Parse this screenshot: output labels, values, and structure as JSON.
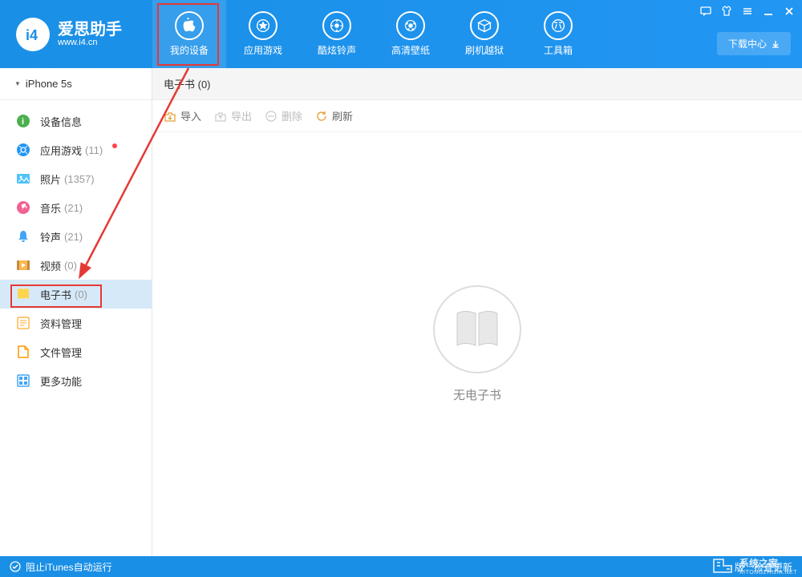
{
  "logo": {
    "title": "爱思助手",
    "url": "www.i4.cn"
  },
  "nav": [
    {
      "label": "我的设备",
      "active": true
    },
    {
      "label": "应用游戏",
      "active": false
    },
    {
      "label": "酷炫铃声",
      "active": false
    },
    {
      "label": "高清壁纸",
      "active": false
    },
    {
      "label": "刷机越狱",
      "active": false
    },
    {
      "label": "工具箱",
      "active": false
    }
  ],
  "download_center": "下载中心",
  "device_name": "iPhone 5s",
  "sidebar": [
    {
      "label": "设备信息",
      "count": "",
      "icon": "info",
      "color": "#4caf50"
    },
    {
      "label": "应用游戏",
      "count": "(11)",
      "icon": "apps",
      "color": "#2196f3",
      "has_dot": true
    },
    {
      "label": "照片",
      "count": "(1357)",
      "icon": "photo",
      "color": "#4fc3f7"
    },
    {
      "label": "音乐",
      "count": "(21)",
      "icon": "music",
      "color": "#f06292"
    },
    {
      "label": "铃声",
      "count": "(21)",
      "icon": "bell",
      "color": "#42a5f5"
    },
    {
      "label": "视频",
      "count": "(0)",
      "icon": "video",
      "color": "#ffb74d"
    },
    {
      "label": "电子书",
      "count": "(0)",
      "icon": "book",
      "color": "#ffd54f",
      "selected": true
    },
    {
      "label": "资料管理",
      "count": "",
      "icon": "data",
      "color": "#ffb74d"
    },
    {
      "label": "文件管理",
      "count": "",
      "icon": "file",
      "color": "#ff9800"
    },
    {
      "label": "更多功能",
      "count": "",
      "icon": "more",
      "color": "#42a5f5"
    }
  ],
  "content_title": "电子书 (0)",
  "toolbar": {
    "import": "导入",
    "export": "导出",
    "delete": "删除",
    "refresh": "刷新"
  },
  "empty_text": "无电子书",
  "footer": {
    "itunes_block": "阻止iTunes自动运行",
    "version": "版",
    "check_update": "检查更新"
  },
  "watermark": {
    "brand": "系统之家",
    "sub": "XITONGZHIJIA.NET"
  }
}
